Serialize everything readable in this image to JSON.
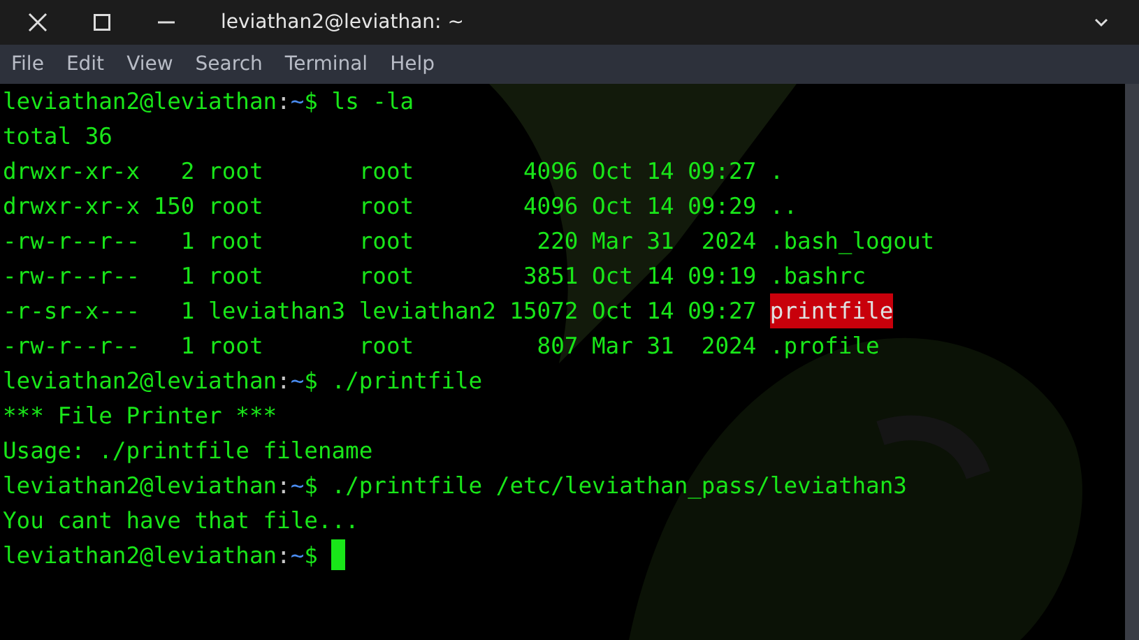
{
  "window": {
    "title": "leviathan2@leviathan: ~"
  },
  "menu": [
    "File",
    "Edit",
    "View",
    "Search",
    "Terminal",
    "Help"
  ],
  "terminal": {
    "lines": [
      [
        {
          "text": "leviathan2@leviathan",
          "kind": "user"
        },
        {
          "text": ":",
          "kind": "sep"
        },
        {
          "text": "~",
          "kind": "path"
        },
        {
          "text": "$ ls -la",
          "kind": "plain"
        }
      ],
      [
        {
          "text": "total 36",
          "kind": "plain"
        }
      ],
      [
        {
          "text": "drwxr-xr-x   2 root       root        4096 Oct 14 09:27 .",
          "kind": "plain"
        }
      ],
      [
        {
          "text": "drwxr-xr-x 150 root       root        4096 Oct 14 09:29 ..",
          "kind": "plain"
        }
      ],
      [
        {
          "text": "-rw-r--r--   1 root       root         220 Mar 31  2024 .bash_logout",
          "kind": "plain"
        }
      ],
      [
        {
          "text": "-rw-r--r--   1 root       root        3851 Oct 14 09:19 .bashrc",
          "kind": "plain"
        }
      ],
      [
        {
          "text": "-r-sr-x---   1 leviathan3 leviathan2 15072 Oct 14 09:27 ",
          "kind": "plain"
        },
        {
          "text": "printfile",
          "kind": "highlight"
        }
      ],
      [
        {
          "text": "-rw-r--r--   1 root       root         807 Mar 31  2024 .profile",
          "kind": "plain"
        }
      ],
      [
        {
          "text": "leviathan2@leviathan",
          "kind": "user"
        },
        {
          "text": ":",
          "kind": "sep"
        },
        {
          "text": "~",
          "kind": "path"
        },
        {
          "text": "$ ./printfile",
          "kind": "plain"
        }
      ],
      [
        {
          "text": "*** File Printer ***",
          "kind": "plain"
        }
      ],
      [
        {
          "text": "Usage: ./printfile filename",
          "kind": "plain"
        }
      ],
      [
        {
          "text": "leviathan2@leviathan",
          "kind": "user"
        },
        {
          "text": ":",
          "kind": "sep"
        },
        {
          "text": "~",
          "kind": "path"
        },
        {
          "text": "$ ./printfile /etc/leviathan_pass/leviathan3",
          "kind": "plain"
        }
      ],
      [
        {
          "text": "You cant have that file...",
          "kind": "plain"
        }
      ],
      [
        {
          "text": "leviathan2@leviathan",
          "kind": "user"
        },
        {
          "text": ":",
          "kind": "sep"
        },
        {
          "text": "~",
          "kind": "path"
        },
        {
          "text": "$ ",
          "kind": "plain"
        }
      ]
    ],
    "cursor": true
  }
}
